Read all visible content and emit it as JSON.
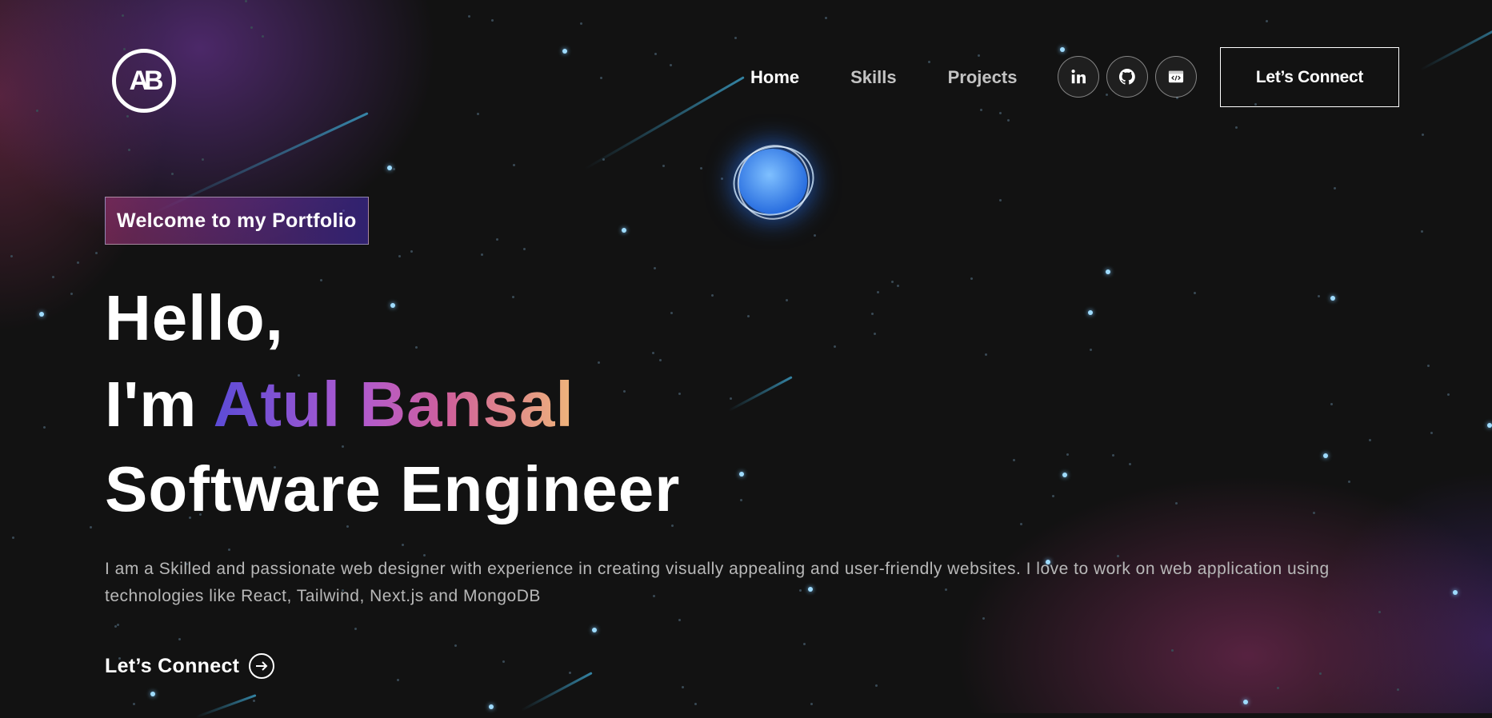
{
  "header": {
    "logo_text": "AB",
    "nav": [
      {
        "label": "Home",
        "active": true
      },
      {
        "label": "Skills",
        "active": false
      },
      {
        "label": "Projects",
        "active": false
      }
    ],
    "socials": [
      "linkedin-icon",
      "github-icon",
      "code-window-icon"
    ],
    "cta_label": "Let’s Connect"
  },
  "hero": {
    "tagline": "Welcome to my Portfolio",
    "line1": "Hello,",
    "line2_prefix": "I'm ",
    "name": "Atul Bansal",
    "role": "Software Engineer",
    "description": "I am a Skilled and passionate web designer with experience in creating visually appealing and user-friendly websites. I love to work on web application using technologies like React, Tailwind, Next.js and MongoDB",
    "cta_label": "Let’s Connect"
  },
  "colors": {
    "background": "#121212",
    "gradient_start": "#5b4bd6",
    "gradient_mid": "#d0609a",
    "gradient_end": "#f0b67a",
    "orb": "#2a6fe0"
  }
}
